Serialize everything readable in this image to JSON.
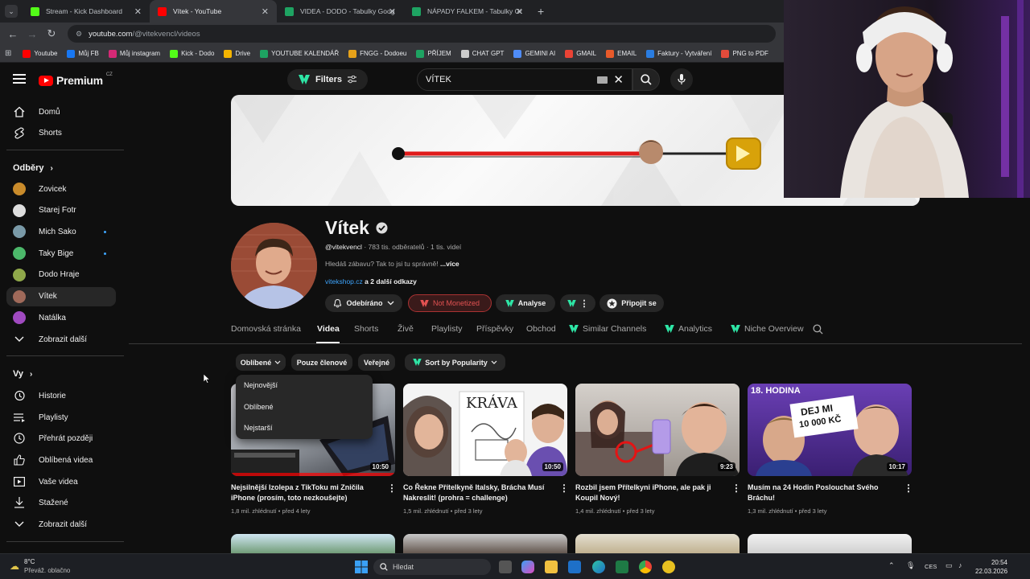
{
  "browser": {
    "tabs": [
      {
        "title": "Stream - Kick Dashboard",
        "color": "#53fc18"
      },
      {
        "title": "Vítek - YouTube",
        "color": "#ff0000"
      },
      {
        "title": "VIDEA - DODO - Tabulky Googl...",
        "color": "#1ea362"
      },
      {
        "title": "NÁPADY FALKEM - Tabulky Goo...",
        "color": "#1ea362"
      }
    ],
    "url_domain": "youtube.com",
    "url_path": "/@vitekvencl/videos",
    "bookmarks": [
      {
        "label": "Youtube",
        "color": "#ff0000"
      },
      {
        "label": "Můj FB",
        "color": "#1877f2"
      },
      {
        "label": "Můj instagram",
        "color": "#d62976"
      },
      {
        "label": "Kick - Dodo",
        "color": "#53fc18"
      },
      {
        "label": "Drive",
        "color": "#f4b400"
      },
      {
        "label": "YOUTUBE KALENDÁŘ",
        "color": "#1ea362"
      },
      {
        "label": "FNGG - Dodoeu",
        "color": "#e6a21a"
      },
      {
        "label": "PŘÍJEM",
        "color": "#1ea362"
      },
      {
        "label": "CHAT GPT",
        "color": "#cccccc"
      },
      {
        "label": "GEMINI AI",
        "color": "#4f8cf7"
      },
      {
        "label": "GMAIL",
        "color": "#ea4335"
      },
      {
        "label": "EMAIL",
        "color": "#e85a2a"
      },
      {
        "label": "Faktury - Vytváření",
        "color": "#2a7de1"
      },
      {
        "label": "PNG to PDF",
        "color": "#e34b3b"
      }
    ]
  },
  "header": {
    "logo_text": "Premium",
    "logo_region": "CZ",
    "filters_label": "Filters",
    "search_value": "VÍTEK"
  },
  "sidebar": {
    "main": [
      {
        "label": "Domů",
        "icon": "home-icon"
      },
      {
        "label": "Shorts",
        "icon": "shorts-icon"
      }
    ],
    "subs_title": "Odběry",
    "subs": [
      {
        "label": "Zovicek",
        "color": "#c98b2b",
        "dot": false
      },
      {
        "label": "Starej Fotr",
        "color": "#dddddd",
        "dot": false
      },
      {
        "label": "Mich Sako",
        "color": "#7a9aa8",
        "dot": true
      },
      {
        "label": "Taky Bige",
        "color": "#4cb86a",
        "dot": true
      },
      {
        "label": "Dodo Hraje",
        "color": "#8fa84a",
        "dot": false
      },
      {
        "label": "Vítek",
        "color": "#a06a5a",
        "dot": false
      },
      {
        "label": "Natálka",
        "color": "#a04ac0",
        "dot": false
      }
    ],
    "subs_more": "Zobrazit další",
    "you_title": "Vy",
    "you": [
      {
        "label": "Historie",
        "icon": "history-icon"
      },
      {
        "label": "Playlisty",
        "icon": "playlist-icon"
      },
      {
        "label": "Přehrát později",
        "icon": "watch-later-icon"
      },
      {
        "label": "Oblíbená videa",
        "icon": "like-icon"
      },
      {
        "label": "Vaše videa",
        "icon": "your-videos-icon"
      },
      {
        "label": "Stažené",
        "icon": "download-icon"
      }
    ],
    "you_more": "Zobrazit další"
  },
  "channel": {
    "name": "Vítek",
    "handle": "@vitekvencl",
    "subscribers": "783 tis. odběratelů",
    "videos_count": "1 tis. videí",
    "description": "Hledáš zábavu? Tak to jsi tu správně!",
    "more": "...více",
    "link": "vitekshop.cz",
    "link_more": "a 2 další odkazy",
    "subscribed_label": "Odebíráno",
    "not_monetized": "Not Monetized",
    "analyse": "Analyse",
    "join": "Připojit se"
  },
  "tabs": [
    "Domovská stránka",
    "Videa",
    "Shorts",
    "Živě",
    "Playlisty",
    "Příspěvky",
    "Obchod",
    "Similar Channels",
    "Analytics",
    "Niche Overview"
  ],
  "filters": {
    "sort": "Oblíbené",
    "members": "Pouze členové",
    "public": "Veřejné",
    "popularity": "Sort by Popularity"
  },
  "dropdown": [
    "Nejnovější",
    "Oblíbené",
    "Nejstarší"
  ],
  "videos": [
    {
      "title": "Nejsilnější Izolepa z TikToku mi Zničila iPhone (prosím, toto nezkoušejte)",
      "views": "1,8 mil. zhlédnutí",
      "age": "před 4 lety",
      "duration": "10:50"
    },
    {
      "title": "Co Řekne Přítelkyně Italsky, Brácha Musí Nakreslit! (prohra = challenge)",
      "views": "1,5 mil. zhlédnutí",
      "age": "před 3 lety",
      "duration": "10:50",
      "thumb_text": "KRÁVA"
    },
    {
      "title": "Rozbil jsem Přítelkyni iPhone, ale pak ji Koupil Nový!",
      "views": "1,4 mil. zhlédnutí",
      "age": "před 3 lety",
      "duration": "9:23"
    },
    {
      "title": "Musím na 24 Hodin Poslouchat Svého Bráchu!",
      "views": "1,3 mil. zhlédnutí",
      "age": "před 3 lety",
      "duration": "10:17",
      "thumb_top": "18. HODINA",
      "thumb_sign_1": "DEJ MI",
      "thumb_sign_2": "10 000 KČ"
    }
  ],
  "taskbar": {
    "temp": "8°C",
    "weather": "Převáž. oblačno",
    "search": "Hledat",
    "lang": "CES",
    "time": "20:54",
    "date": "22.03.2026"
  }
}
